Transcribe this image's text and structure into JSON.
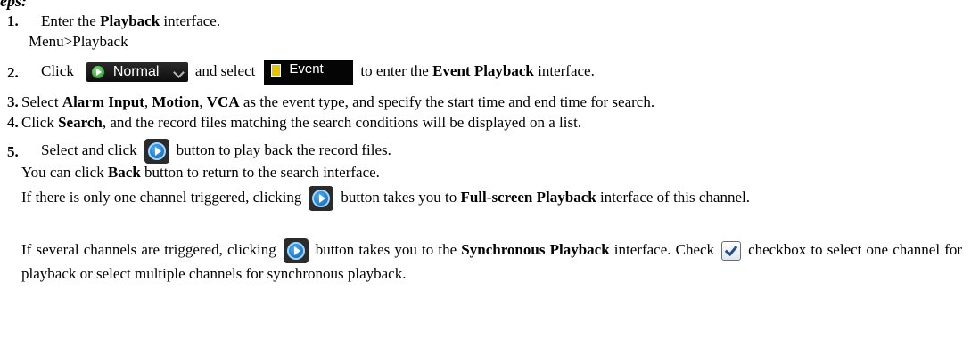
{
  "heading": "eps:",
  "steps": [
    {
      "num": "1.",
      "text_a": "Enter the ",
      "bold_a": "Playback",
      "text_b": " interface.",
      "sub": "Menu>Playback"
    },
    {
      "num": "2.",
      "text_a": "Click",
      "normal_label": "Normal",
      "text_b": "and select",
      "event_label": "Event",
      "text_c": "to enter the ",
      "bold_a": "Event Playback",
      "text_d": " interface."
    },
    {
      "num": "3.",
      "text_a": "Select ",
      "bold_a": "Alarm Input",
      "text_b": ", ",
      "bold_b": "Motion",
      "text_c": ", ",
      "bold_c": "VCA",
      "text_d": " as the event type, and specify the start time and end time for search."
    },
    {
      "num": "4.",
      "text_a": "Click ",
      "bold_a": "Search",
      "text_b": ", and the record files matching the search conditions will be displayed on a list."
    },
    {
      "num": "5.",
      "text_a": "Select and click",
      "text_b": "button to play back the record files."
    }
  ],
  "notes": {
    "back": {
      "text_a": "You can click ",
      "bold_a": "Back",
      "text_b": " button to return to the search interface."
    },
    "one_channel": {
      "text_a": "If there is only one channel triggered, clicking",
      "text_b": "button takes you to ",
      "bold_a": "Full-screen Playback",
      "text_c": " interface of this channel."
    },
    "several": {
      "text_a": "If several channels are triggered, clicking",
      "text_b": "button takes you to the ",
      "bold_a": "Synchronous Playback",
      "text_c": " interface. Check",
      "text_d": "checkbox to select one channel for playback or select multiple channels for synchronous playback."
    }
  }
}
